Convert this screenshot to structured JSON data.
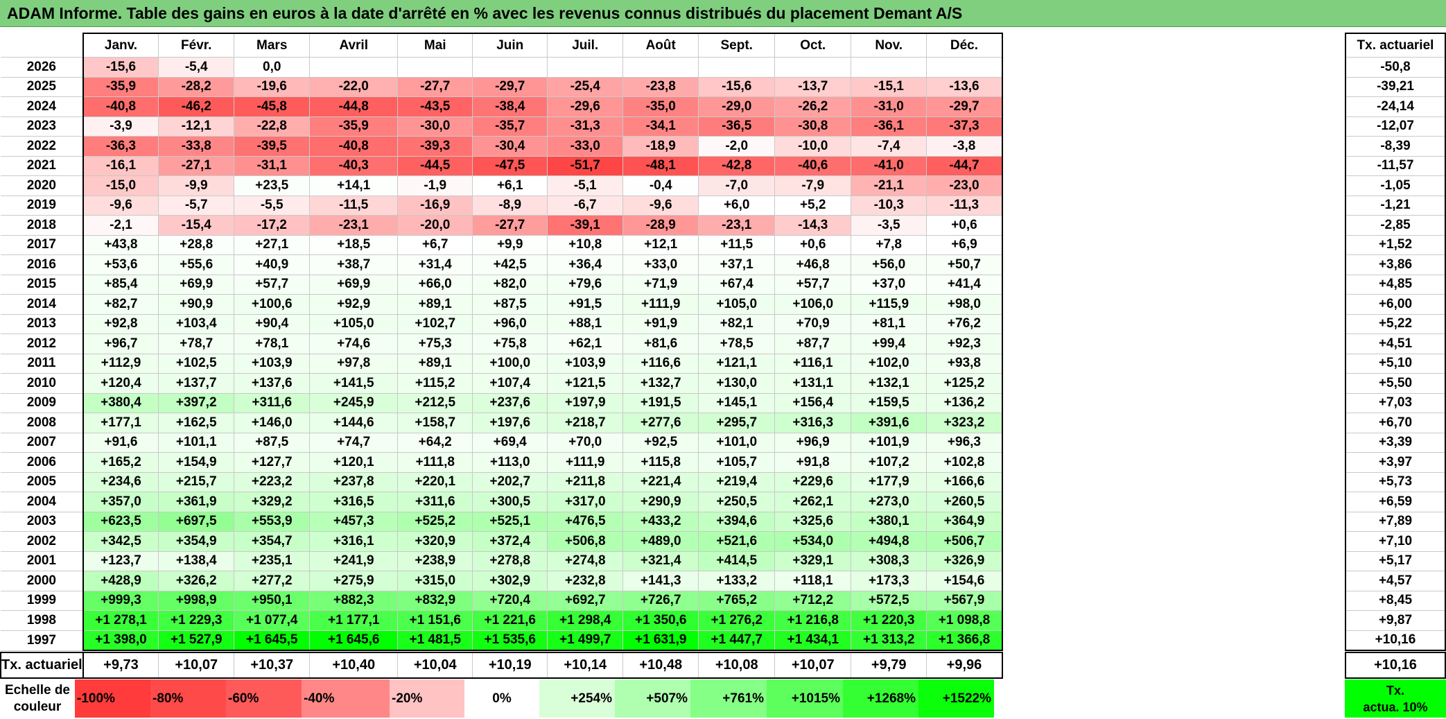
{
  "title": "ADAM Informe. Table des gains en euros à la date d'arrêté en % avec les revenus connus distribués du placement Demant A/S",
  "months": [
    "Janv.",
    "Févr.",
    "Mars",
    "Avril",
    "Mai",
    "Juin",
    "Juil.",
    "Août",
    "Sept.",
    "Oct.",
    "Nov.",
    "Déc."
  ],
  "tx_header": "Tx. actuariel",
  "rows": [
    {
      "year": "2026",
      "values": [
        "-15,6",
        "-5,4",
        "0,0",
        "",
        "",
        "",
        "",
        "",
        "",
        "",
        "",
        ""
      ],
      "tx": "-50,8"
    },
    {
      "year": "2025",
      "values": [
        "-35,9",
        "-28,2",
        "-19,6",
        "-22,0",
        "-27,7",
        "-29,7",
        "-25,4",
        "-23,8",
        "-15,6",
        "-13,7",
        "-15,1",
        "-13,6"
      ],
      "tx": "-39,21"
    },
    {
      "year": "2024",
      "values": [
        "-40,8",
        "-46,2",
        "-45,8",
        "-44,8",
        "-43,5",
        "-38,4",
        "-29,6",
        "-35,0",
        "-29,0",
        "-26,2",
        "-31,0",
        "-29,7"
      ],
      "tx": "-24,14"
    },
    {
      "year": "2023",
      "values": [
        "-3,9",
        "-12,1",
        "-22,8",
        "-35,9",
        "-30,0",
        "-35,7",
        "-31,3",
        "-34,1",
        "-36,5",
        "-30,8",
        "-36,1",
        "-37,3"
      ],
      "tx": "-12,07"
    },
    {
      "year": "2022",
      "values": [
        "-36,3",
        "-33,8",
        "-39,5",
        "-40,8",
        "-39,3",
        "-30,4",
        "-33,0",
        "-18,9",
        "-2,0",
        "-10,0",
        "-7,4",
        "-3,8"
      ],
      "tx": "-8,39"
    },
    {
      "year": "2021",
      "values": [
        "-16,1",
        "-27,1",
        "-31,1",
        "-40,3",
        "-44,5",
        "-47,5",
        "-51,7",
        "-48,1",
        "-42,8",
        "-40,6",
        "-41,0",
        "-44,7"
      ],
      "tx": "-11,57"
    },
    {
      "year": "2020",
      "values": [
        "-15,0",
        "-9,9",
        "+23,5",
        "+14,1",
        "-1,9",
        "+6,1",
        "-5,1",
        "-0,4",
        "-7,0",
        "-7,9",
        "-21,1",
        "-23,0"
      ],
      "tx": "-1,05"
    },
    {
      "year": "2019",
      "values": [
        "-9,6",
        "-5,7",
        "-5,5",
        "-11,5",
        "-16,9",
        "-8,9",
        "-6,7",
        "-9,6",
        "+6,0",
        "+5,2",
        "-10,3",
        "-11,3"
      ],
      "tx": "-1,21"
    },
    {
      "year": "2018",
      "values": [
        "-2,1",
        "-15,4",
        "-17,2",
        "-23,1",
        "-20,0",
        "-27,7",
        "-39,1",
        "-28,9",
        "-23,1",
        "-14,3",
        "-3,5",
        "+0,6"
      ],
      "tx": "-2,85"
    },
    {
      "year": "2017",
      "values": [
        "+43,8",
        "+28,8",
        "+27,1",
        "+18,5",
        "+6,7",
        "+9,9",
        "+10,8",
        "+12,1",
        "+11,5",
        "+0,6",
        "+7,8",
        "+6,9"
      ],
      "tx": "+1,52"
    },
    {
      "year": "2016",
      "values": [
        "+53,6",
        "+55,6",
        "+40,9",
        "+38,7",
        "+31,4",
        "+42,5",
        "+36,4",
        "+33,0",
        "+37,1",
        "+46,8",
        "+56,0",
        "+50,7"
      ],
      "tx": "+3,86"
    },
    {
      "year": "2015",
      "values": [
        "+85,4",
        "+69,9",
        "+57,7",
        "+69,9",
        "+66,0",
        "+82,0",
        "+79,6",
        "+71,9",
        "+67,4",
        "+57,7",
        "+37,0",
        "+41,4"
      ],
      "tx": "+4,85"
    },
    {
      "year": "2014",
      "values": [
        "+82,7",
        "+90,9",
        "+100,6",
        "+92,9",
        "+89,1",
        "+87,5",
        "+91,5",
        "+111,9",
        "+105,0",
        "+106,0",
        "+115,9",
        "+98,0"
      ],
      "tx": "+6,00"
    },
    {
      "year": "2013",
      "values": [
        "+92,8",
        "+103,4",
        "+90,4",
        "+105,0",
        "+102,7",
        "+96,0",
        "+88,1",
        "+91,9",
        "+82,1",
        "+70,9",
        "+81,1",
        "+76,2"
      ],
      "tx": "+5,22"
    },
    {
      "year": "2012",
      "values": [
        "+96,7",
        "+78,7",
        "+78,1",
        "+74,6",
        "+75,3",
        "+75,8",
        "+62,1",
        "+81,6",
        "+78,5",
        "+87,7",
        "+99,4",
        "+92,3"
      ],
      "tx": "+4,51"
    },
    {
      "year": "2011",
      "values": [
        "+112,9",
        "+102,5",
        "+103,9",
        "+97,8",
        "+89,1",
        "+100,0",
        "+103,9",
        "+116,6",
        "+121,1",
        "+116,1",
        "+102,0",
        "+93,8"
      ],
      "tx": "+5,10"
    },
    {
      "year": "2010",
      "values": [
        "+120,4",
        "+137,7",
        "+137,6",
        "+141,5",
        "+115,2",
        "+107,4",
        "+121,5",
        "+132,7",
        "+130,0",
        "+131,1",
        "+132,1",
        "+125,2"
      ],
      "tx": "+5,50"
    },
    {
      "year": "2009",
      "values": [
        "+380,4",
        "+397,2",
        "+311,6",
        "+245,9",
        "+212,5",
        "+237,6",
        "+197,9",
        "+191,5",
        "+145,1",
        "+156,4",
        "+159,5",
        "+136,2"
      ],
      "tx": "+7,03"
    },
    {
      "year": "2008",
      "values": [
        "+177,1",
        "+162,5",
        "+146,0",
        "+144,6",
        "+158,7",
        "+197,6",
        "+218,7",
        "+277,6",
        "+295,7",
        "+316,3",
        "+391,6",
        "+323,2"
      ],
      "tx": "+6,70"
    },
    {
      "year": "2007",
      "values": [
        "+91,6",
        "+101,1",
        "+87,5",
        "+74,7",
        "+64,2",
        "+69,4",
        "+70,0",
        "+92,5",
        "+101,0",
        "+96,9",
        "+101,9",
        "+96,3"
      ],
      "tx": "+3,39"
    },
    {
      "year": "2006",
      "values": [
        "+165,2",
        "+154,9",
        "+127,7",
        "+120,1",
        "+111,8",
        "+113,0",
        "+111,9",
        "+115,8",
        "+105,7",
        "+91,8",
        "+107,2",
        "+102,8"
      ],
      "tx": "+3,97"
    },
    {
      "year": "2005",
      "values": [
        "+234,6",
        "+215,7",
        "+223,2",
        "+237,8",
        "+220,1",
        "+202,7",
        "+211,8",
        "+221,4",
        "+219,4",
        "+229,6",
        "+177,9",
        "+166,6"
      ],
      "tx": "+5,73"
    },
    {
      "year": "2004",
      "values": [
        "+357,0",
        "+361,9",
        "+329,2",
        "+316,5",
        "+311,6",
        "+300,5",
        "+317,0",
        "+290,9",
        "+250,5",
        "+262,1",
        "+273,0",
        "+260,5"
      ],
      "tx": "+6,59"
    },
    {
      "year": "2003",
      "values": [
        "+623,5",
        "+697,5",
        "+553,9",
        "+457,3",
        "+525,2",
        "+525,1",
        "+476,5",
        "+433,2",
        "+394,6",
        "+325,6",
        "+380,1",
        "+364,9"
      ],
      "tx": "+7,89"
    },
    {
      "year": "2002",
      "values": [
        "+342,5",
        "+354,9",
        "+354,7",
        "+316,1",
        "+320,9",
        "+372,4",
        "+506,8",
        "+489,0",
        "+521,6",
        "+534,0",
        "+494,8",
        "+506,7"
      ],
      "tx": "+7,10"
    },
    {
      "year": "2001",
      "values": [
        "+123,7",
        "+138,4",
        "+235,1",
        "+241,9",
        "+238,9",
        "+278,8",
        "+274,8",
        "+321,4",
        "+414,5",
        "+329,1",
        "+308,3",
        "+326,9"
      ],
      "tx": "+5,17"
    },
    {
      "year": "2000",
      "values": [
        "+428,9",
        "+326,2",
        "+277,2",
        "+275,9",
        "+315,0",
        "+302,9",
        "+232,8",
        "+141,3",
        "+133,2",
        "+118,1",
        "+173,3",
        "+154,6"
      ],
      "tx": "+4,57"
    },
    {
      "year": "1999",
      "values": [
        "+999,3",
        "+998,9",
        "+950,1",
        "+882,3",
        "+832,9",
        "+720,4",
        "+692,7",
        "+726,7",
        "+765,2",
        "+712,2",
        "+572,5",
        "+567,9"
      ],
      "tx": "+8,45"
    },
    {
      "year": "1998",
      "values": [
        "+1 278,1",
        "+1 229,3",
        "+1 077,4",
        "+1 177,1",
        "+1 151,6",
        "+1 221,6",
        "+1 298,4",
        "+1 350,6",
        "+1 276,2",
        "+1 216,8",
        "+1 220,3",
        "+1 098,8"
      ],
      "tx": "+9,87"
    },
    {
      "year": "1997",
      "values": [
        "+1 398,0",
        "+1 527,9",
        "+1 645,5",
        "+1 645,6",
        "+1 481,5",
        "+1 535,6",
        "+1 499,7",
        "+1 631,9",
        "+1 447,7",
        "+1 434,1",
        "+1 313,2",
        "+1 366,8"
      ],
      "tx": "+10,16"
    }
  ],
  "act_row": {
    "label": "Tx. actuariel",
    "values": [
      "+9,73",
      "+10,07",
      "+10,37",
      "+10,40",
      "+10,04",
      "+10,19",
      "+10,14",
      "+10,48",
      "+10,08",
      "+10,07",
      "+9,79",
      "+9,96"
    ],
    "tx": "+10,16"
  },
  "legend": {
    "label_line1": "Echelle de",
    "label_line2": "couleur",
    "items": [
      {
        "text": "-100%",
        "color": "#ff3b3b",
        "align": "neg"
      },
      {
        "text": "-80%",
        "color": "#ff4a4a",
        "align": "neg"
      },
      {
        "text": "-60%",
        "color": "#ff5a5a",
        "align": "neg"
      },
      {
        "text": "-40%",
        "color": "#ff8787",
        "align": "neg"
      },
      {
        "text": "-20%",
        "color": "#ffc3c3",
        "align": "neg"
      },
      {
        "text": "0%",
        "color": "#ffffff",
        "align": "center"
      },
      {
        "text": "+254%",
        "color": "#d9ffd9",
        "align": "pos"
      },
      {
        "text": "+507%",
        "color": "#b0ffb0",
        "align": "pos"
      },
      {
        "text": "+761%",
        "color": "#86ff86",
        "align": "pos"
      },
      {
        "text": "+1015%",
        "color": "#5cff5c",
        "align": "pos"
      },
      {
        "text": "+1268%",
        "color": "#33ff33",
        "align": "pos"
      },
      {
        "text": "+1522%",
        "color": "#0bff0b",
        "align": "pos"
      }
    ],
    "act_line1": "Tx.",
    "act_line2": "actua. 10%",
    "act_color": "#00ff00"
  },
  "colors": {
    "title_bg": "#7fcf7f",
    "negative_full": "#ff3b3b",
    "positive_full": "#00ff00",
    "neutral": "#ffffff"
  }
}
